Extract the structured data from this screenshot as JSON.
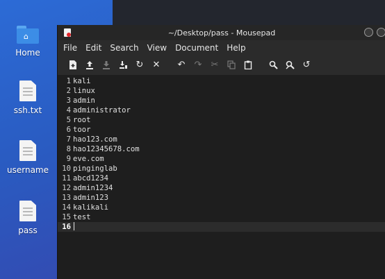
{
  "desktop": {
    "icons": [
      {
        "label": "Home"
      },
      {
        "label": "ssh.txt"
      },
      {
        "label": "username"
      },
      {
        "label": "pass"
      }
    ]
  },
  "window": {
    "title": "~/Desktop/pass - Mousepad",
    "menu": [
      "File",
      "Edit",
      "Search",
      "View",
      "Document",
      "Help"
    ],
    "toolbar_icons": [
      "new-document-icon",
      "open-icon",
      "save-icon",
      "save-as-icon",
      "reload-icon",
      "close-icon",
      "undo-icon",
      "redo-icon",
      "cut-icon",
      "copy-icon",
      "paste-icon",
      "find-icon",
      "find-replace-icon",
      "go-to-line-icon"
    ]
  },
  "editor": {
    "lines": [
      {
        "num": "1",
        "text": "kali"
      },
      {
        "num": "2",
        "text": "linux"
      },
      {
        "num": "3",
        "text": "admin"
      },
      {
        "num": "4",
        "text": "administrator"
      },
      {
        "num": "5",
        "text": "root"
      },
      {
        "num": "6",
        "text": "toor"
      },
      {
        "num": "7",
        "text": "hao123.com"
      },
      {
        "num": "8",
        "text": "hao12345678.com"
      },
      {
        "num": "9",
        "text": "eve.com"
      },
      {
        "num": "10",
        "text": "pinginglab"
      },
      {
        "num": "11",
        "text": "abcd1234"
      },
      {
        "num": "12",
        "text": "admin1234"
      },
      {
        "num": "13",
        "text": "admin123"
      },
      {
        "num": "14",
        "text": "kalikali"
      },
      {
        "num": "15",
        "text": "test"
      },
      {
        "num": "16",
        "text": ""
      }
    ],
    "current_line": "16"
  }
}
